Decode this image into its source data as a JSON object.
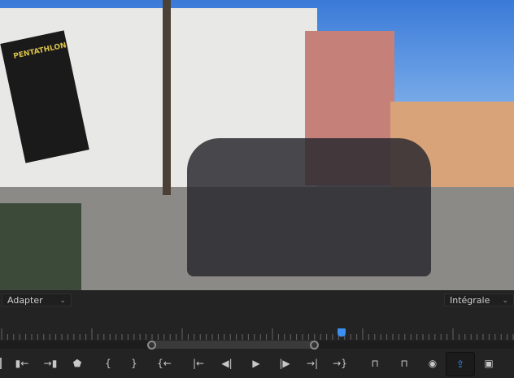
{
  "video": {
    "flag_text": "PENTATHLON"
  },
  "controls": {
    "zoom_select": {
      "value": "Adapter"
    },
    "quality_select": {
      "value": "Intégrale"
    },
    "playhead_position_fraction": 0.665,
    "zoom_range_fraction": [
      0.295,
      0.61
    ],
    "accent_color": "#3b8ff0",
    "buttons": [
      {
        "name": "add-marker",
        "icon": "marker-in-arrow",
        "glyph": "▮←"
      },
      {
        "name": "go-to-marker",
        "icon": "arrow-marker",
        "glyph": "→▮"
      },
      {
        "name": "add-marker-button",
        "icon": "marker",
        "glyph": "⬟"
      },
      {
        "name": "mark-in",
        "icon": "brace-left",
        "glyph": "{"
      },
      {
        "name": "mark-out",
        "icon": "brace-right",
        "glyph": "}"
      },
      {
        "name": "go-to-in",
        "icon": "go-to-in",
        "glyph": "{←"
      },
      {
        "name": "step-back-to-start",
        "icon": "step-to-start",
        "glyph": "|←"
      },
      {
        "name": "step-back",
        "icon": "step-back",
        "glyph": "◀|"
      },
      {
        "name": "play",
        "icon": "play",
        "glyph": "▶"
      },
      {
        "name": "step-forward",
        "icon": "step-forward",
        "glyph": "|▶"
      },
      {
        "name": "step-to-end",
        "icon": "step-to-end",
        "glyph": "→|"
      },
      {
        "name": "go-to-out",
        "icon": "go-to-out",
        "glyph": "→}"
      },
      {
        "name": "insert",
        "icon": "insert",
        "glyph": "⊓"
      },
      {
        "name": "overwrite",
        "icon": "overwrite",
        "glyph": "⊓"
      },
      {
        "name": "export-frame",
        "icon": "camera",
        "glyph": "◉"
      },
      {
        "name": "export",
        "icon": "export",
        "glyph": "⇪"
      },
      {
        "name": "multi-camera",
        "icon": "film-stack",
        "glyph": "▣"
      }
    ]
  }
}
